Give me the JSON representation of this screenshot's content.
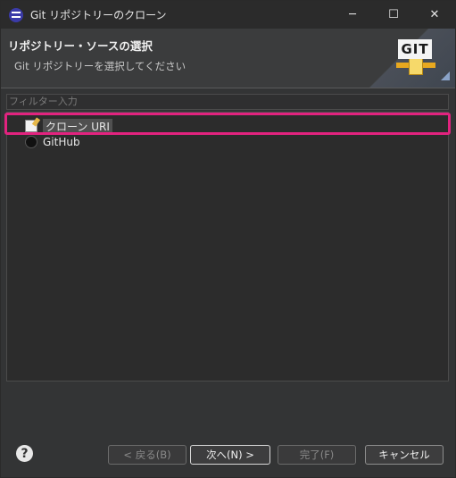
{
  "window": {
    "title": "Git リポジトリーのクローン",
    "minimize": "─",
    "maximize": "☐",
    "close": "✕"
  },
  "header": {
    "title": "リポジトリー・ソースの選択",
    "description": "Git リポジトリーを選択してください",
    "logo_text": "GIT"
  },
  "filter": {
    "placeholder": "フィルター入力"
  },
  "tree": {
    "items": [
      {
        "label": "クローン URI",
        "icon": "clone-uri-icon",
        "selected": true
      },
      {
        "label": "GitHub",
        "icon": "github-icon",
        "selected": false
      }
    ]
  },
  "buttons": {
    "help": "?",
    "back": "< 戻る(B)",
    "next": "次へ(N) >",
    "finish": "完了(F)",
    "cancel": "キャンセル"
  },
  "colors": {
    "highlight": "#e2237f"
  }
}
